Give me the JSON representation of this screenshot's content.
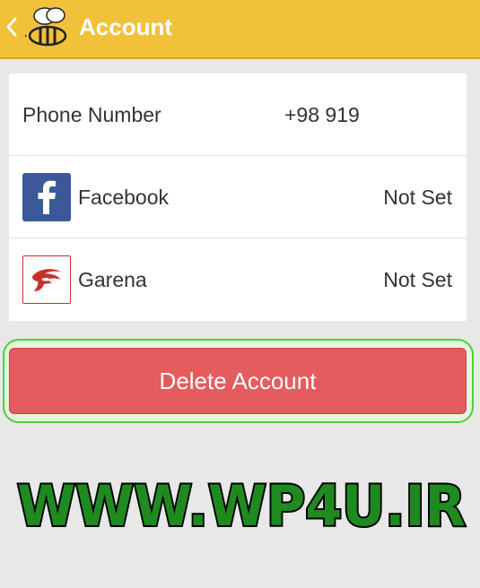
{
  "header": {
    "title": "Account",
    "back_icon": "chevron-left-icon",
    "logo_icon": "bee-logo-icon",
    "background": "#f2c13a"
  },
  "account_list": {
    "rows": [
      {
        "label": "Phone Number",
        "value": "+98 919"
      },
      {
        "label": "Facebook",
        "value": "Not Set",
        "icon": "facebook-icon"
      },
      {
        "label": "Garena",
        "value": "Not Set",
        "icon": "garena-icon"
      }
    ]
  },
  "delete_button": {
    "label": "Delete Account",
    "color": "#e45c5d"
  },
  "watermark": {
    "text": "WWW.WP4U.IR"
  }
}
